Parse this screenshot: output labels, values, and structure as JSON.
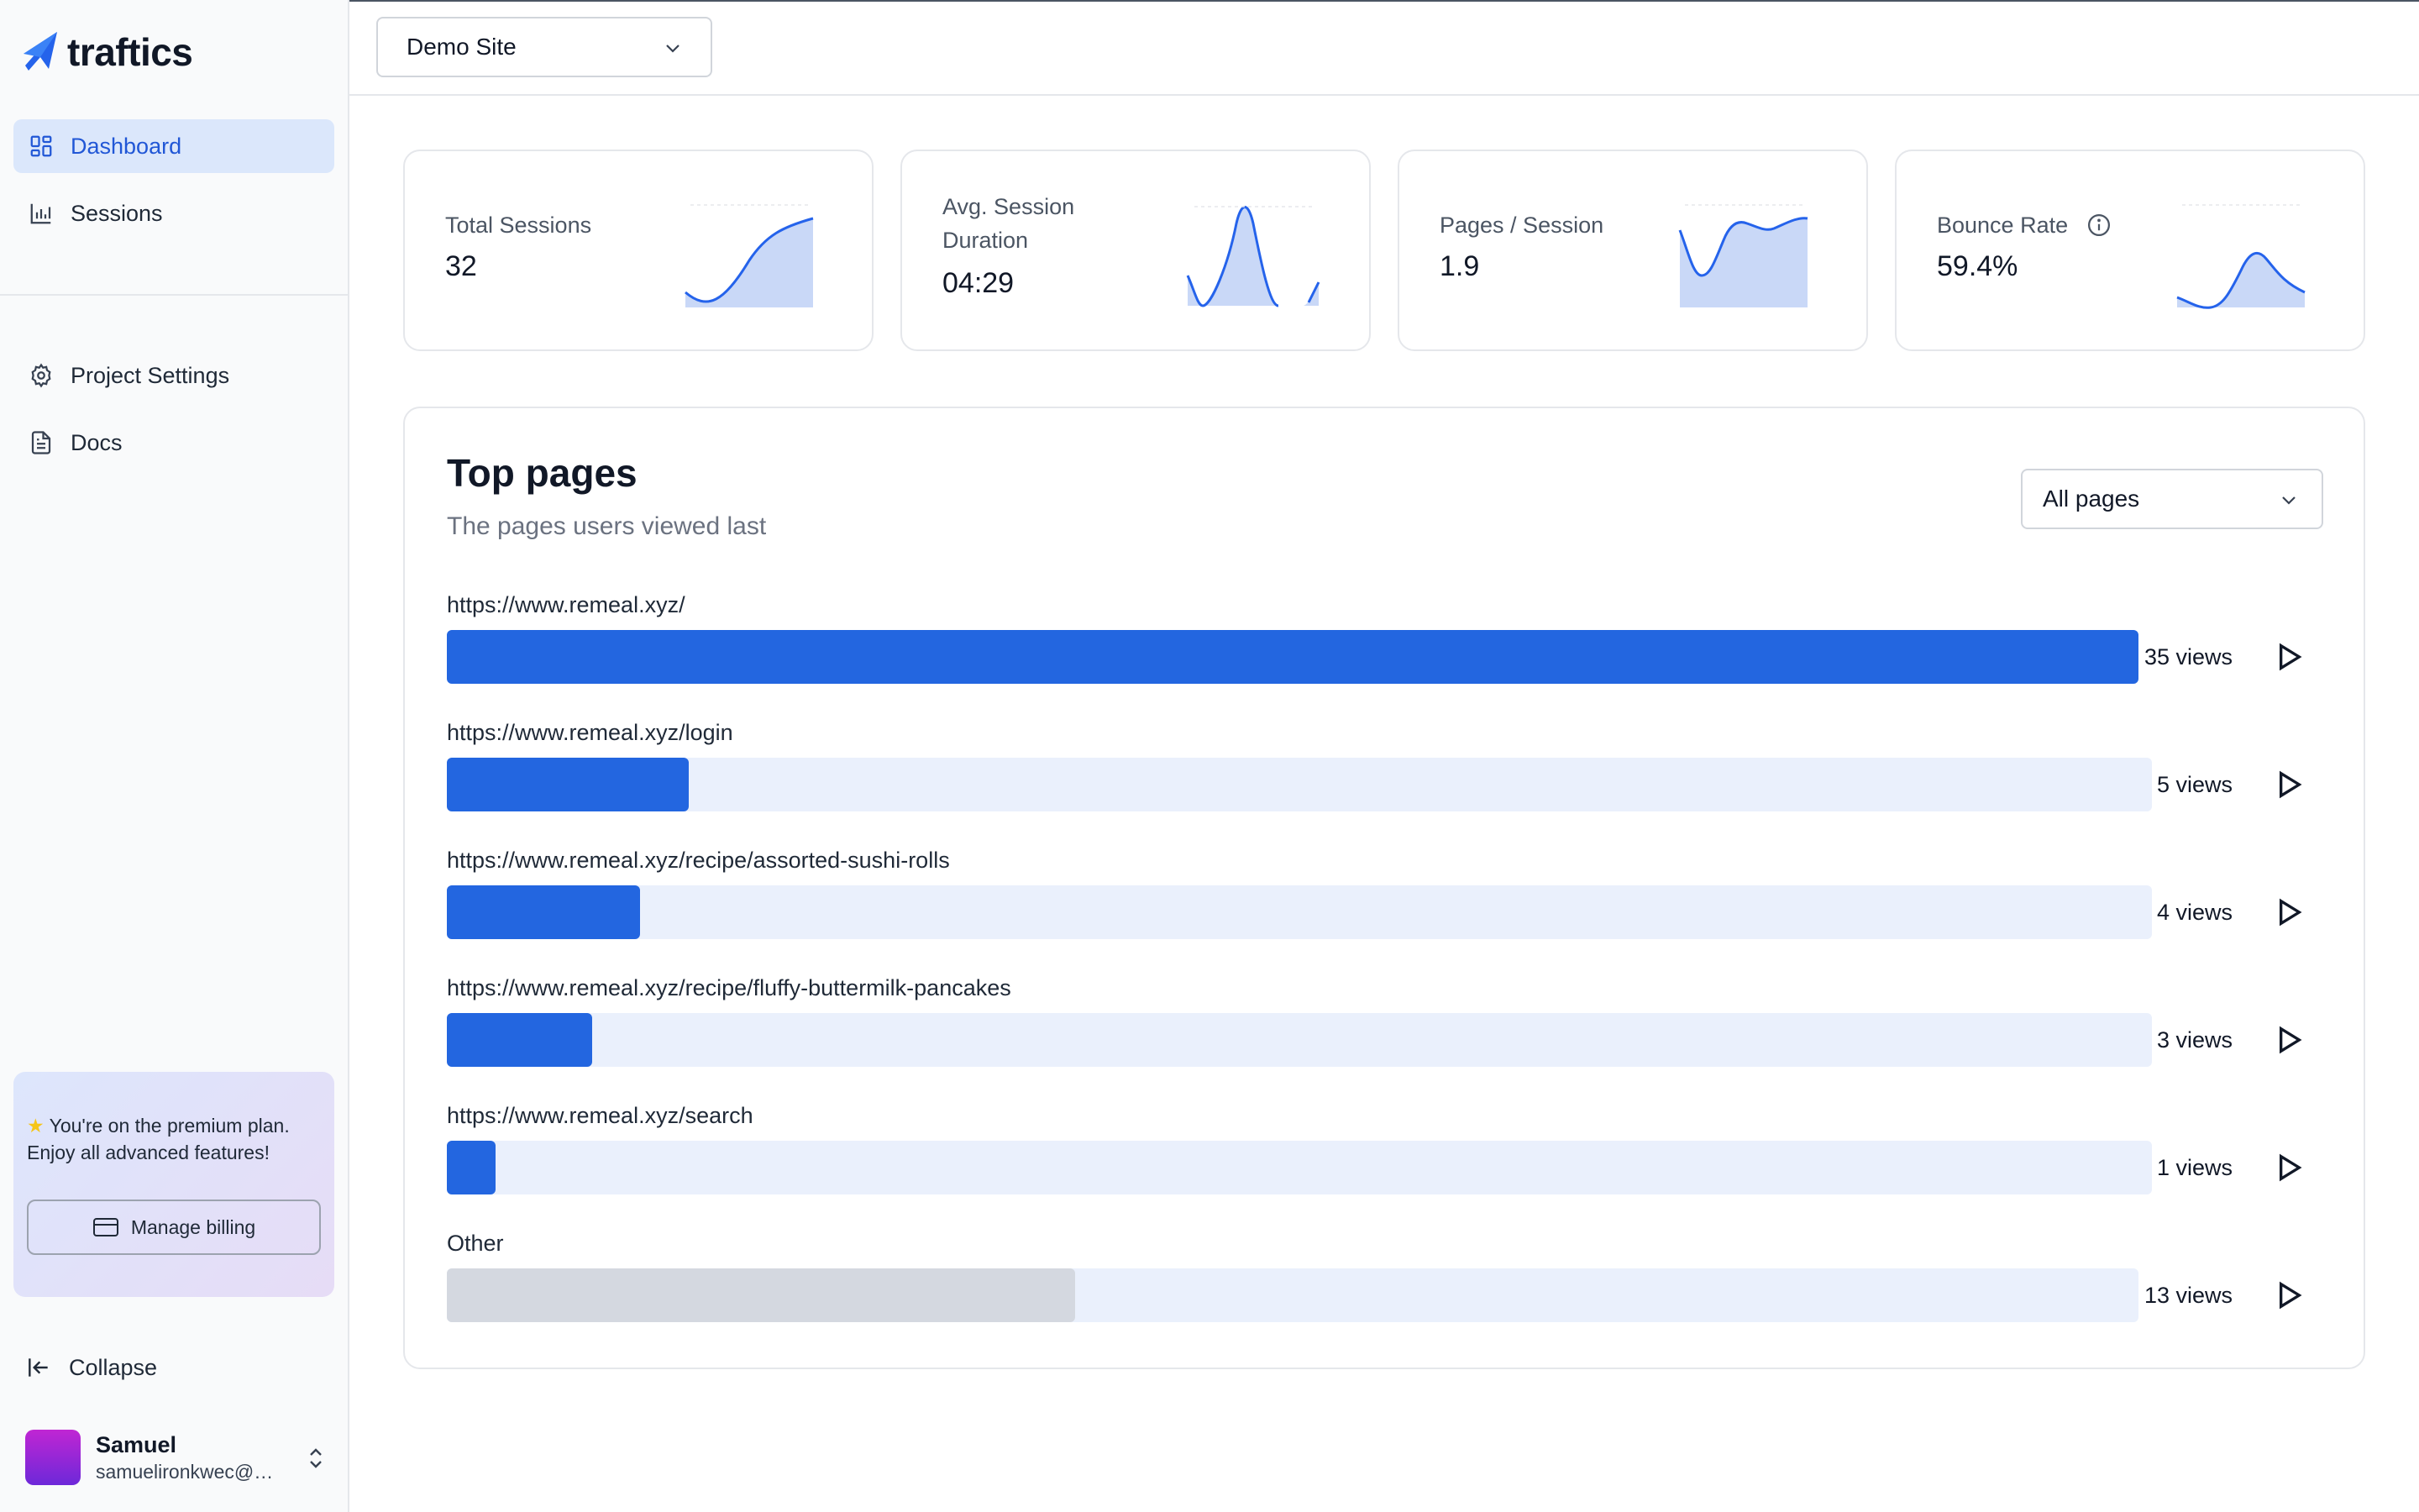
{
  "app": {
    "name": "traftics",
    "accent": "#2563eb"
  },
  "sidebar": {
    "items": [
      {
        "label": "Dashboard",
        "icon": "dashboard-icon",
        "active": true
      },
      {
        "label": "Sessions",
        "icon": "bar-chart-icon",
        "active": false
      },
      {
        "label": "Project Settings",
        "icon": "gear-icon",
        "active": false
      },
      {
        "label": "Docs",
        "icon": "document-icon",
        "active": false
      }
    ],
    "promo": {
      "icon": "star-icon",
      "line1": "You're on the premium plan.",
      "line2": "Enjoy all advanced features!",
      "button_label": "Manage billing"
    },
    "collapse_label": "Collapse",
    "user": {
      "name": "Samuel",
      "email": "samuelironkwec@…"
    }
  },
  "header": {
    "site_select": "Demo Site"
  },
  "stats": [
    {
      "label_line1": "Total Sessions",
      "label_line2": "",
      "value": "32"
    },
    {
      "label_line1": "Avg. Session",
      "label_line2": "Duration",
      "value": "04:29"
    },
    {
      "label_line1": "Pages / Session",
      "label_line2": "",
      "value": "1.9"
    },
    {
      "label_line1": "Bounce Rate",
      "label_line2": "",
      "value": "59.4%"
    }
  ],
  "top_pages": {
    "title": "Top pages",
    "subtitle": "The pages users viewed last",
    "filter": "All pages",
    "max_views": 35,
    "rows": [
      {
        "label": "https://www.remeal.xyz/",
        "views": 35,
        "count_label": "35 views",
        "color": "#2366e0"
      },
      {
        "label": "https://www.remeal.xyz/login",
        "views": 5,
        "count_label": "5 views",
        "color": "#2366e0"
      },
      {
        "label": "https://www.remeal.xyz/recipe/assorted-sushi-rolls",
        "views": 4,
        "count_label": "4 views",
        "color": "#2366e0"
      },
      {
        "label": "https://www.remeal.xyz/recipe/fluffy-buttermilk-pancakes",
        "views": 3,
        "count_label": "3 views",
        "color": "#2366e0"
      },
      {
        "label": "https://www.remeal.xyz/search",
        "views": 1,
        "count_label": "1 views",
        "color": "#2366e0"
      },
      {
        "label": "Other",
        "views": 13,
        "count_label": "13 views",
        "color": "#d4d8e0"
      }
    ]
  }
}
